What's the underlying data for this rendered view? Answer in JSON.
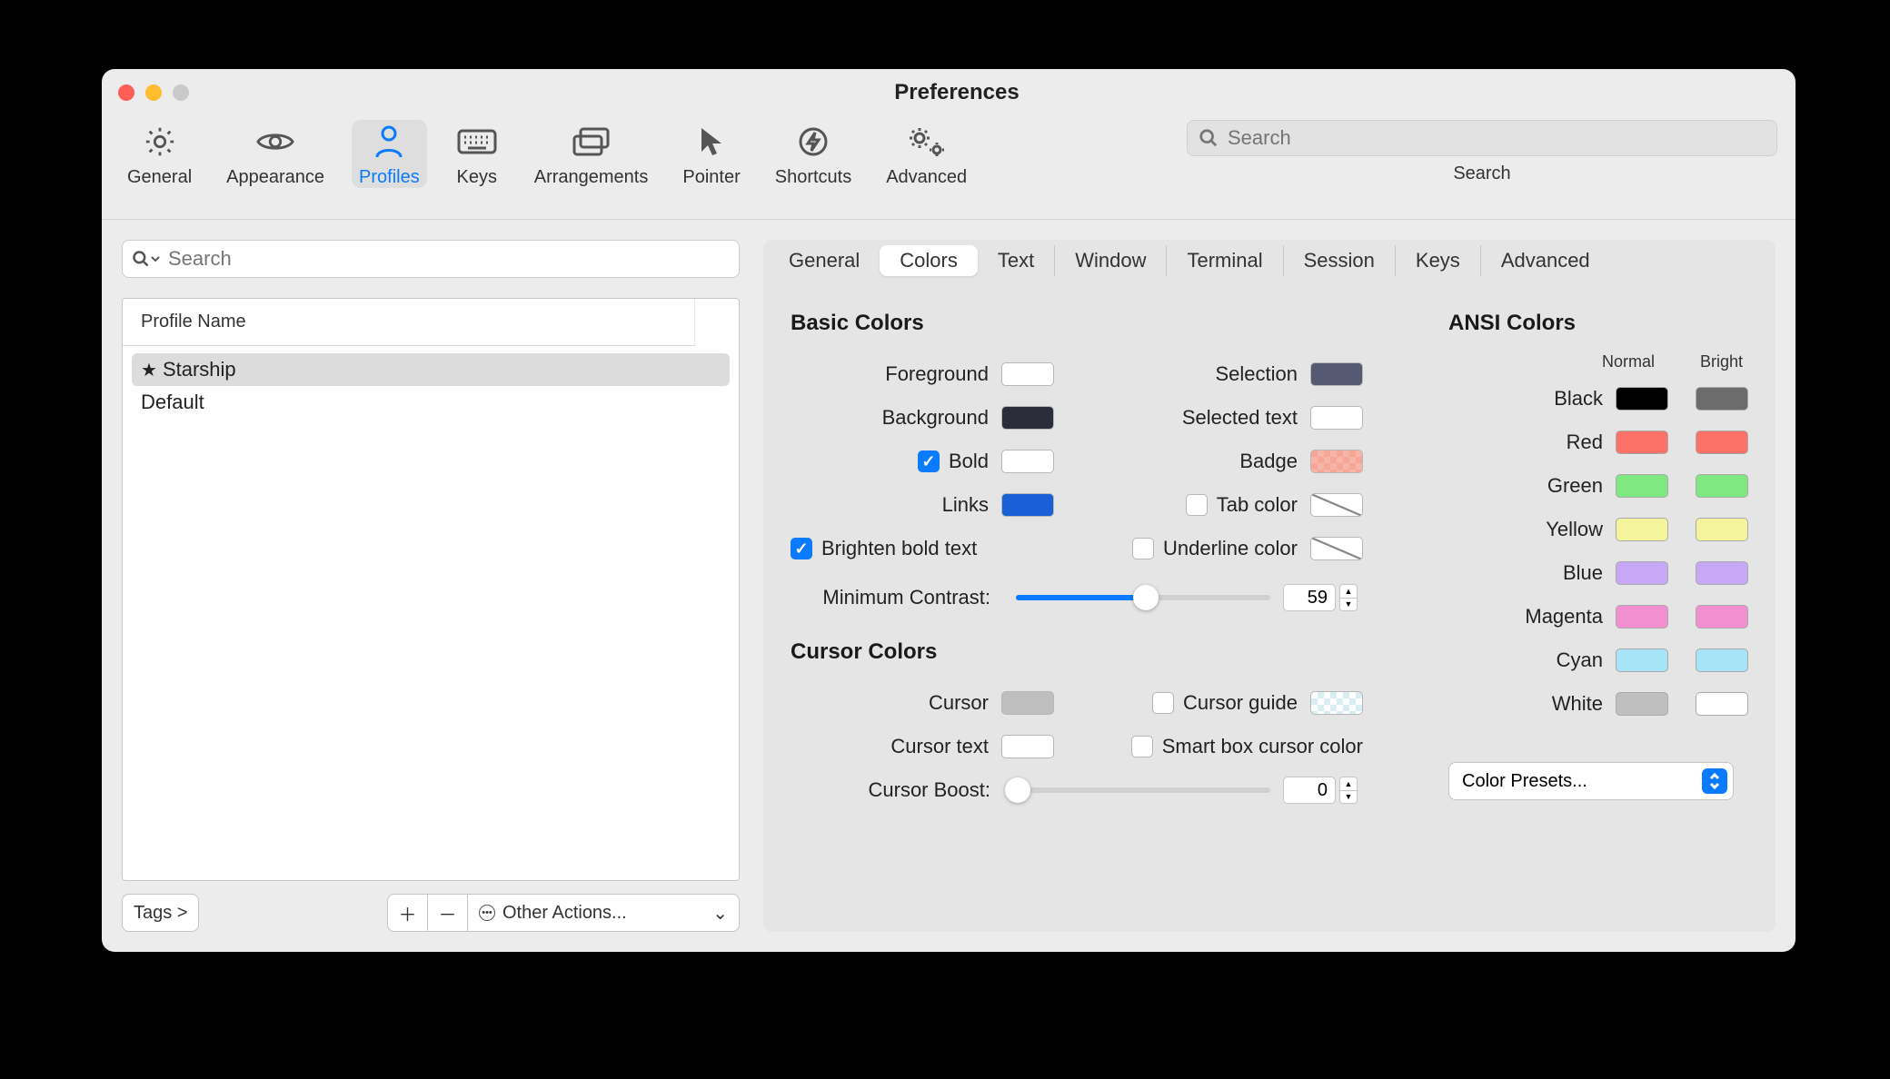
{
  "window": {
    "title": "Preferences"
  },
  "toolbar": {
    "items": [
      {
        "id": "general",
        "label": "General"
      },
      {
        "id": "appearance",
        "label": "Appearance"
      },
      {
        "id": "profiles",
        "label": "Profiles",
        "active": true
      },
      {
        "id": "keys",
        "label": "Keys"
      },
      {
        "id": "arrangements",
        "label": "Arrangements"
      },
      {
        "id": "pointer",
        "label": "Pointer"
      },
      {
        "id": "shortcuts",
        "label": "Shortcuts"
      },
      {
        "id": "advanced",
        "label": "Advanced"
      }
    ],
    "search_placeholder": "Search",
    "search_label": "Search"
  },
  "sidebar": {
    "search_placeholder": "Search",
    "header": "Profile Name",
    "profiles": [
      {
        "name": "Starship",
        "default": true,
        "selected": true
      },
      {
        "name": "Default",
        "default": false,
        "selected": false
      }
    ],
    "tags_button": "Tags >",
    "other_actions": "Other Actions..."
  },
  "subtabs": [
    {
      "id": "general",
      "label": "General"
    },
    {
      "id": "colors",
      "label": "Colors",
      "active": true
    },
    {
      "id": "text",
      "label": "Text"
    },
    {
      "id": "window",
      "label": "Window"
    },
    {
      "id": "terminal",
      "label": "Terminal"
    },
    {
      "id": "session",
      "label": "Session"
    },
    {
      "id": "keys",
      "label": "Keys"
    },
    {
      "id": "advanced",
      "label": "Advanced"
    }
  ],
  "basic_colors": {
    "heading": "Basic Colors",
    "foreground": {
      "label": "Foreground",
      "color": "#ffffff"
    },
    "background": {
      "label": "Background",
      "color": "#2b2d3a"
    },
    "bold": {
      "label": "Bold",
      "checked": true,
      "color": "#ffffff"
    },
    "links": {
      "label": "Links",
      "color": "#1a5fd6"
    },
    "selection": {
      "label": "Selection",
      "color": "#555a72"
    },
    "selected_text": {
      "label": "Selected text",
      "color": "#ffffff"
    },
    "badge": {
      "label": "Badge"
    },
    "tab_color": {
      "label": "Tab color",
      "checked": false
    },
    "underline_color": {
      "label": "Underline color",
      "checked": false
    },
    "brighten_bold": {
      "label": "Brighten bold text",
      "checked": true
    },
    "min_contrast": {
      "label": "Minimum Contrast:",
      "value": "59",
      "percent": 51
    }
  },
  "cursor_colors": {
    "heading": "Cursor Colors",
    "cursor": {
      "label": "Cursor",
      "color": "#bfbfbf"
    },
    "cursor_text": {
      "label": "Cursor text",
      "color": "#ffffff"
    },
    "cursor_guide": {
      "label": "Cursor guide",
      "checked": false
    },
    "smart_box": {
      "label": "Smart box cursor color",
      "checked": false
    },
    "cursor_boost": {
      "label": "Cursor Boost:",
      "value": "0",
      "percent": 0
    }
  },
  "ansi": {
    "heading": "ANSI Colors",
    "col_normal": "Normal",
    "col_bright": "Bright",
    "rows": [
      {
        "label": "Black",
        "normal": "#000000",
        "bright": "#6c6c6c"
      },
      {
        "label": "Red",
        "normal": "#fc7168",
        "bright": "#fc7168"
      },
      {
        "label": "Green",
        "normal": "#7fe881",
        "bright": "#7fe881"
      },
      {
        "label": "Yellow",
        "normal": "#f4f49c",
        "bright": "#f4f49c"
      },
      {
        "label": "Blue",
        "normal": "#c6a8f7",
        "bright": "#c6a8f7"
      },
      {
        "label": "Magenta",
        "normal": "#f28fd0",
        "bright": "#f28fd0"
      },
      {
        "label": "Cyan",
        "normal": "#a7e4f7",
        "bright": "#a7e4f7"
      },
      {
        "label": "White",
        "normal": "#bfbfbf",
        "bright": "#ffffff"
      }
    ]
  },
  "preset_label": "Color Presets..."
}
